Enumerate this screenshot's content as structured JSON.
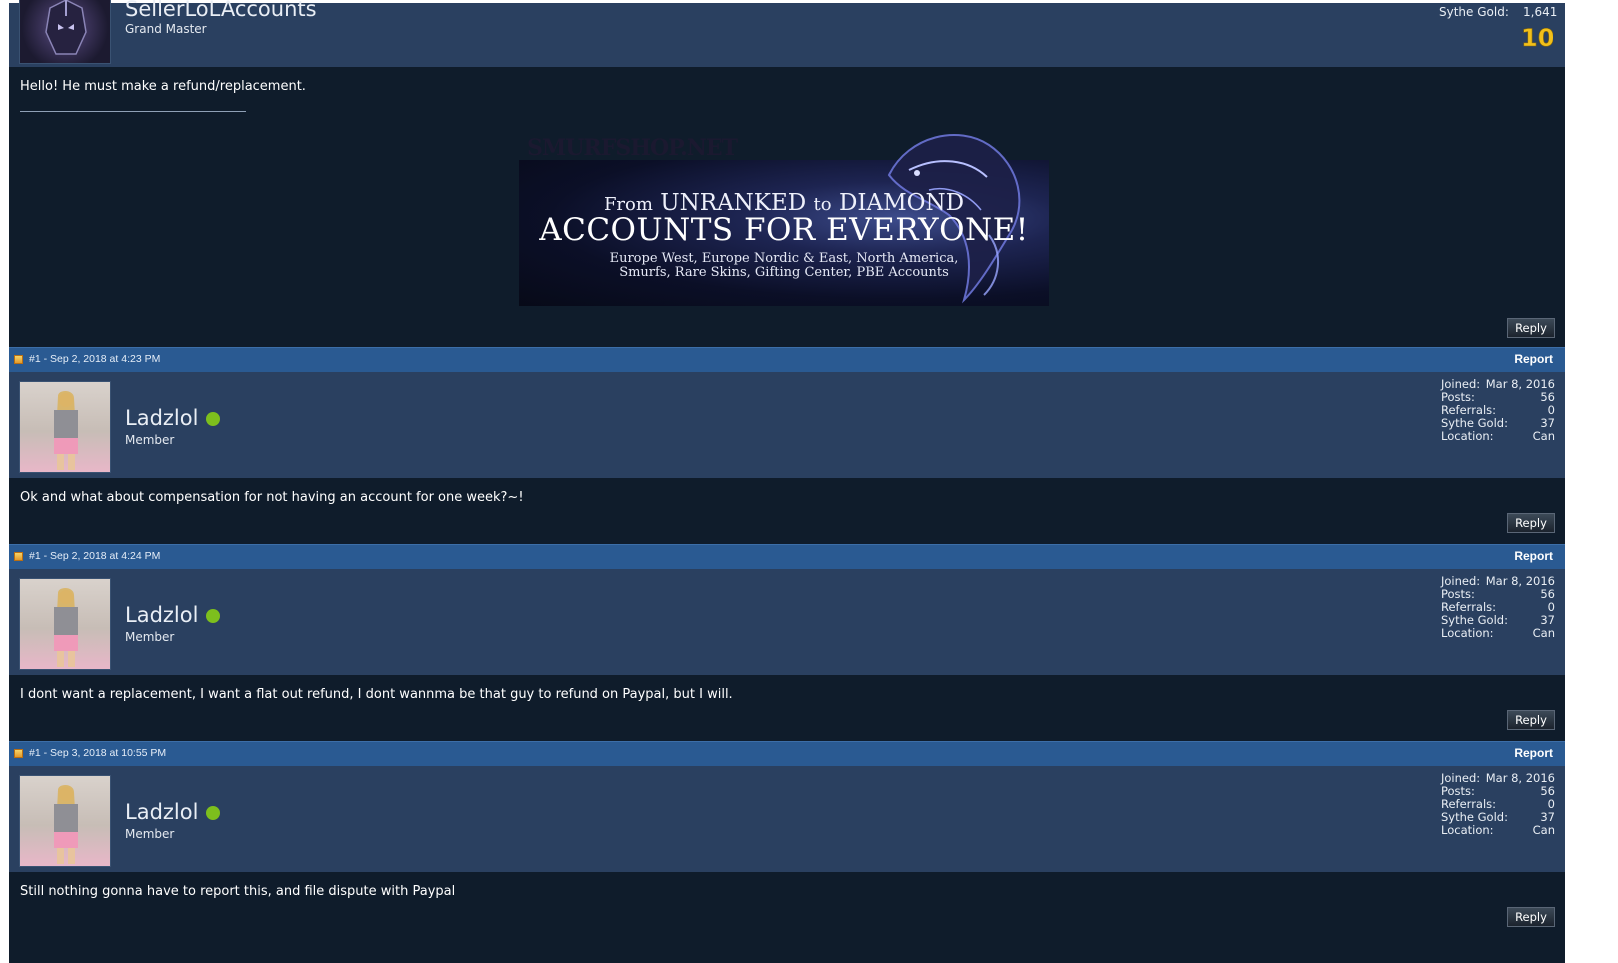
{
  "first_post": {
    "username": "SellerLoLAccounts",
    "usertitle": "Grand Master",
    "sythe_gold_label": "Sythe Gold:",
    "sythe_gold_value": "1,641",
    "badge_text": "10",
    "message": "Hello! He must make a refund/replacement.",
    "banner": {
      "site_text": "SMURFSHOP.NET",
      "line1_from": "From",
      "line1_unranked": "UNRANKED",
      "line1_to": "to",
      "line1_diamond": "DIAMOND",
      "line2": "ACCOUNTS FOR EVERYONE!",
      "line3a": "Europe West, Europe Nordic & East, North America,",
      "line3b": "Smurfs, Rare Skins, Gifting Center, PBE Accounts"
    },
    "reply_label": "Reply"
  },
  "posts": [
    {
      "header_text": "#1 - Sep 2, 2018 at 4:23 PM",
      "report_label": "Report",
      "username": "Ladzlol",
      "usertitle": "Member",
      "stats": {
        "joined_label": "Joined:",
        "joined": "Mar 8, 2016",
        "posts_label": "Posts:",
        "posts": "56",
        "referrals_label": "Referrals:",
        "referrals": "0",
        "gold_label": "Sythe Gold:",
        "gold": "37",
        "location_label": "Location:",
        "location": "Can"
      },
      "message": "Ok and what about compensation for not having an account for one week?~!",
      "reply_label": "Reply"
    },
    {
      "header_text": "#1 - Sep 2, 2018 at 4:24 PM",
      "report_label": "Report",
      "username": "Ladzlol",
      "usertitle": "Member",
      "stats": {
        "joined_label": "Joined:",
        "joined": "Mar 8, 2016",
        "posts_label": "Posts:",
        "posts": "56",
        "referrals_label": "Referrals:",
        "referrals": "0",
        "gold_label": "Sythe Gold:",
        "gold": "37",
        "location_label": "Location:",
        "location": "Can"
      },
      "message": "I dont want a replacement, I want a flat out refund, I dont wannma be that guy to refund on Paypal, but I will.",
      "reply_label": "Reply"
    },
    {
      "header_text": "#1 - Sep 3, 2018 at 10:55 PM",
      "report_label": "Report",
      "username": "Ladzlol",
      "usertitle": "Member",
      "stats": {
        "joined_label": "Joined:",
        "joined": "Mar 8, 2016",
        "posts_label": "Posts:",
        "posts": "56",
        "referrals_label": "Referrals:",
        "referrals": "0",
        "gold_label": "Sythe Gold:",
        "gold": "37",
        "location_label": "Location:",
        "location": "Can"
      },
      "message": "Still nothing gonna have to report this, and file dispute with Paypal",
      "reply_label": "Reply"
    }
  ],
  "colors": {
    "header_bar": "#2a5a92",
    "userbar": "#2a4060",
    "message_bg": "#0f1c2b",
    "online": "#7dbf1d",
    "badge": "#f2c01a"
  },
  "icons": [
    "post-icon",
    "online-status-icon",
    "gold-badge-icon"
  ]
}
